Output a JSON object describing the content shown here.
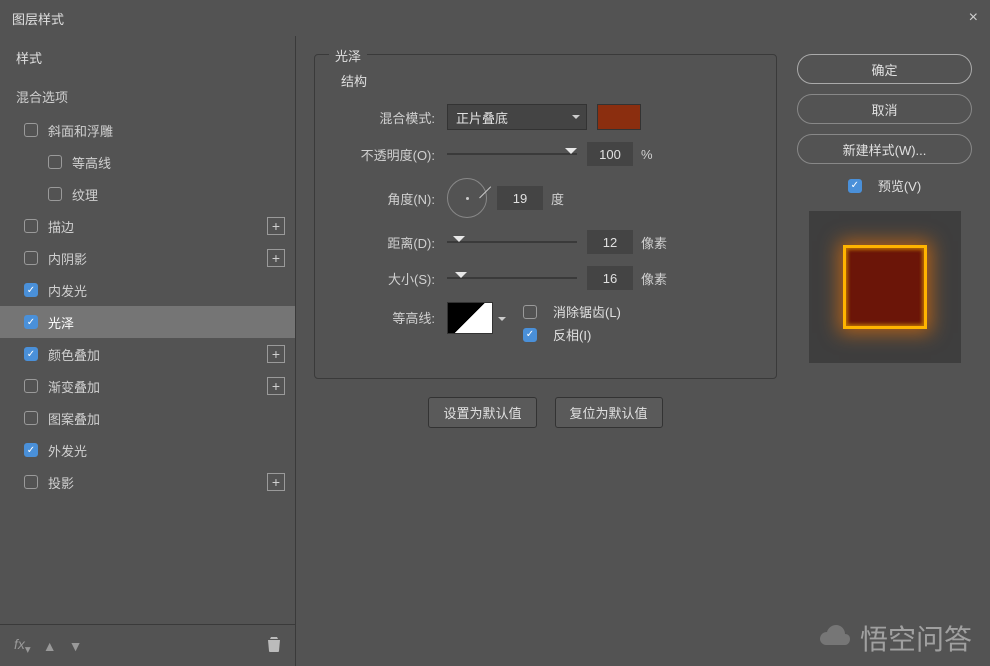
{
  "window": {
    "title": "图层样式"
  },
  "sidebar": {
    "header": "样式",
    "blend_options": "混合选项",
    "items": [
      {
        "label": "斜面和浮雕",
        "checked": false,
        "add": false,
        "indent": false
      },
      {
        "label": "等高线",
        "checked": false,
        "add": false,
        "indent": true
      },
      {
        "label": "纹理",
        "checked": false,
        "add": false,
        "indent": true
      },
      {
        "label": "描边",
        "checked": false,
        "add": true,
        "indent": false
      },
      {
        "label": "内阴影",
        "checked": false,
        "add": true,
        "indent": false
      },
      {
        "label": "内发光",
        "checked": true,
        "add": false,
        "indent": false
      },
      {
        "label": "光泽",
        "checked": true,
        "add": false,
        "indent": false,
        "selected": true
      },
      {
        "label": "颜色叠加",
        "checked": true,
        "add": true,
        "indent": false
      },
      {
        "label": "渐变叠加",
        "checked": false,
        "add": true,
        "indent": false
      },
      {
        "label": "图案叠加",
        "checked": false,
        "add": false,
        "indent": false
      },
      {
        "label": "外发光",
        "checked": true,
        "add": false,
        "indent": false
      },
      {
        "label": "投影",
        "checked": false,
        "add": true,
        "indent": false
      }
    ],
    "footer_fx": "fx"
  },
  "panel": {
    "title": "光泽",
    "structure": "结构",
    "blend_mode_label": "混合模式:",
    "blend_mode_value": "正片叠底",
    "color": "#8b2e0f",
    "opacity_label": "不透明度(O):",
    "opacity_value": "100",
    "opacity_unit": "%",
    "angle_label": "角度(N):",
    "angle_value": "19",
    "angle_unit": "度",
    "distance_label": "距离(D):",
    "distance_value": "12",
    "distance_unit": "像素",
    "size_label": "大小(S):",
    "size_value": "16",
    "size_unit": "像素",
    "contour_label": "等高线:",
    "antialias_label": "消除锯齿(L)",
    "antialias_checked": false,
    "invert_label": "反相(I)",
    "invert_checked": true,
    "make_default": "设置为默认值",
    "reset_default": "复位为默认值"
  },
  "right": {
    "ok": "确定",
    "cancel": "取消",
    "new_style": "新建样式(W)...",
    "preview_label": "预览(V)",
    "preview_checked": true
  },
  "watermark": "悟空问答"
}
